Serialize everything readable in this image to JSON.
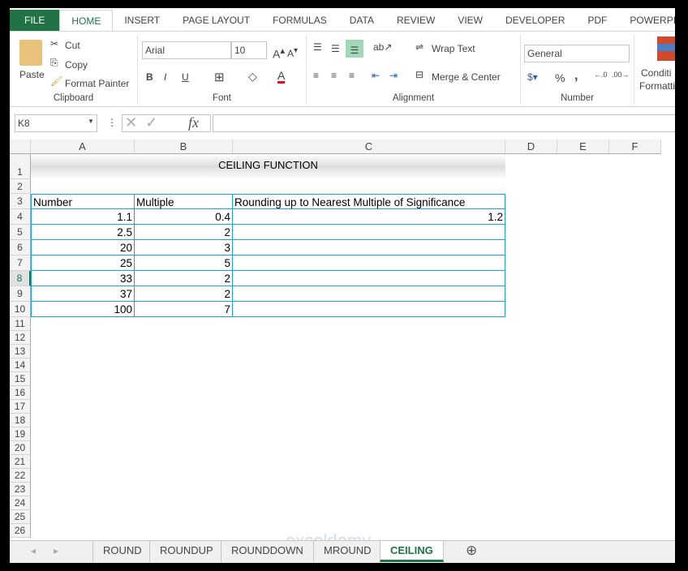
{
  "ribbon_tabs": [
    "FILE",
    "HOME",
    "INSERT",
    "PAGE LAYOUT",
    "FORMULAS",
    "DATA",
    "REVIEW",
    "VIEW",
    "DEVELOPER",
    "PDF",
    "POWERPIVOT"
  ],
  "active_tab": "HOME",
  "clipboard": {
    "paste": "Paste",
    "cut": "Cut",
    "copy": "Copy",
    "format_painter": "Format Painter",
    "label": "Clipboard"
  },
  "font": {
    "name": "Arial",
    "size": "10",
    "bold": "B",
    "italic": "I",
    "underline": "U",
    "label": "Font",
    "font_color": "#e81123"
  },
  "alignment": {
    "wrap_text": "Wrap Text",
    "merge_center": "Merge & Center",
    "label": "Alignment"
  },
  "number": {
    "format": "General",
    "percent": "%",
    "comma": ",",
    "label": "Number"
  },
  "styles": {
    "conditional_line1": "Conditi",
    "conditional_line2": "Formatti"
  },
  "formula_bar": {
    "name_box": "K8",
    "fx": "fx",
    "formula": ""
  },
  "columns": [
    "A",
    "B",
    "C",
    "D",
    "E",
    "F"
  ],
  "rows": [
    "1",
    "2",
    "3",
    "4",
    "5",
    "6",
    "7",
    "8",
    "9",
    "10",
    "11",
    "12",
    "13",
    "14",
    "15",
    "16",
    "17",
    "18",
    "19",
    "20",
    "21",
    "22",
    "23",
    "24",
    "25",
    "26"
  ],
  "selected_row": "8",
  "sheet": {
    "title": "CEILING FUNCTION",
    "headers": [
      "Number",
      "Multiple",
      "Rounding up to Nearest Multiple of Significance"
    ],
    "data": [
      [
        "1.1",
        "0.4",
        "1.2"
      ],
      [
        "2.5",
        "2",
        ""
      ],
      [
        "20",
        "3",
        ""
      ],
      [
        "25",
        "5",
        ""
      ],
      [
        "33",
        "2",
        ""
      ],
      [
        "37",
        "2",
        ""
      ],
      [
        "100",
        "7",
        ""
      ]
    ]
  },
  "sheet_tabs": [
    "ROUND",
    "ROUNDUP",
    "ROUNDDOWN",
    "MROUND",
    "CEILING"
  ],
  "active_sheet": "CEILING",
  "watermark": "exceldemy",
  "accent": "#217346",
  "table_border": "#1ba1e2"
}
